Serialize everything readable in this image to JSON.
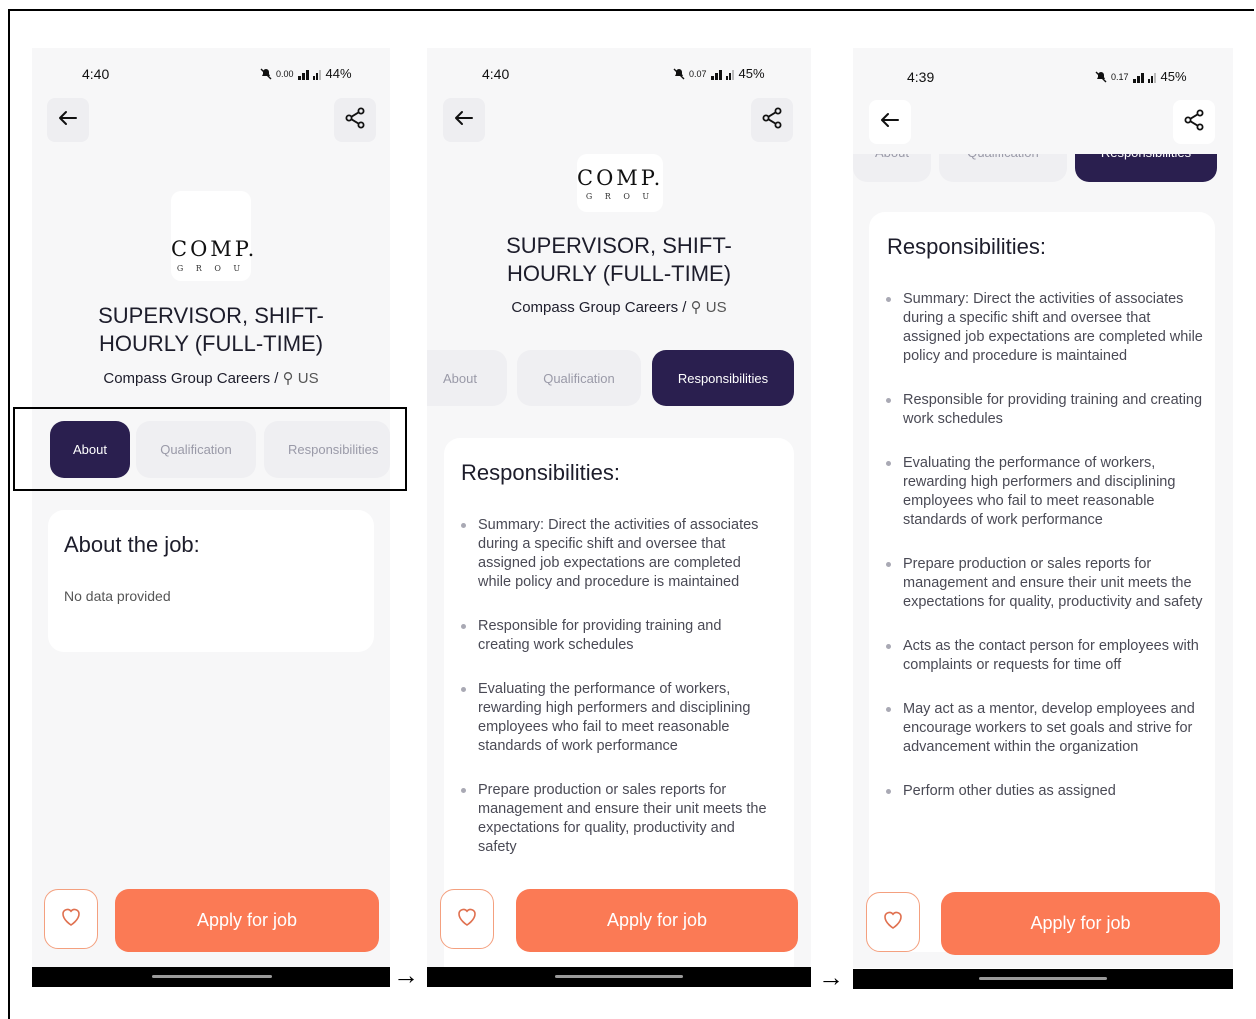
{
  "screens": [
    {
      "time": "4:40",
      "net_speed": "0.00",
      "battery": "44%",
      "logo_text": "COMP.",
      "logo_sub": "G R O U",
      "job_title": "SUPERVISOR, SHIFT-HOURLY (FULL-TIME)",
      "company": "Compass Group Careers /",
      "location": "US",
      "tabs": [
        "About",
        "Qualification",
        "Responsibilities"
      ],
      "active_tab": "About",
      "section_title": "About the job:",
      "section_body": "No data provided",
      "apply_label": "Apply for job"
    },
    {
      "time": "4:40",
      "net_speed": "0.07",
      "battery": "45%",
      "logo_text": "COMP.",
      "logo_sub": "G R O U",
      "job_title": "SUPERVISOR, SHIFT-HOURLY (FULL-TIME)",
      "company": "Compass Group Careers /",
      "location": "US",
      "tabs": [
        "About",
        "Qualification",
        "Responsibilities"
      ],
      "active_tab": "Responsibilities",
      "section_title": "Responsibilities:",
      "responsibilities": [
        "Summary: Direct the activities of associates during a specific shift and oversee that assigned job expectations are completed while policy and procedure is maintained",
        "Responsible for providing training and creating work schedules",
        "Evaluating the performance of workers, rewarding high performers and disciplining employees who fail to meet reasonable standards of work performance",
        "Prepare production or sales reports for management and ensure their unit meets the expectations for quality, productivity and safety"
      ],
      "apply_label": "Apply for job"
    },
    {
      "time": "4:39",
      "net_speed": "0.17",
      "battery": "45%",
      "tabs": [
        "About",
        "Qualification",
        "Responsibilities"
      ],
      "active_tab": "Responsibilities",
      "section_title": "Responsibilities:",
      "responsibilities": [
        "Summary: Direct the activities of associates during a specific shift and oversee that assigned job expectations are completed while policy and procedure is maintained",
        "Responsible for providing training and creating work schedules",
        "Evaluating the performance of workers, rewarding high performers and disciplining employees who fail to meet reasonable standards of work performance",
        "Prepare production or sales reports for management and ensure their unit meets the expectations for quality, productivity and safety",
        "Acts as the contact person for employees with complaints or requests for time off",
        "May act as a mentor, develop employees and encourage workers to set goals and strive for advancement within the organization",
        "Perform other duties as assigned"
      ],
      "apply_label": "Apply for job"
    }
  ],
  "flow_arrow": "→",
  "colors": {
    "accent": "#fb7a55",
    "active_tab": "#2a1f4f",
    "background": "#f7f7f8"
  },
  "icons": [
    "back-arrow-icon",
    "share-icon",
    "heart-icon",
    "location-pin-icon",
    "mute-icon",
    "signal-icon",
    "wifi-icon"
  ]
}
